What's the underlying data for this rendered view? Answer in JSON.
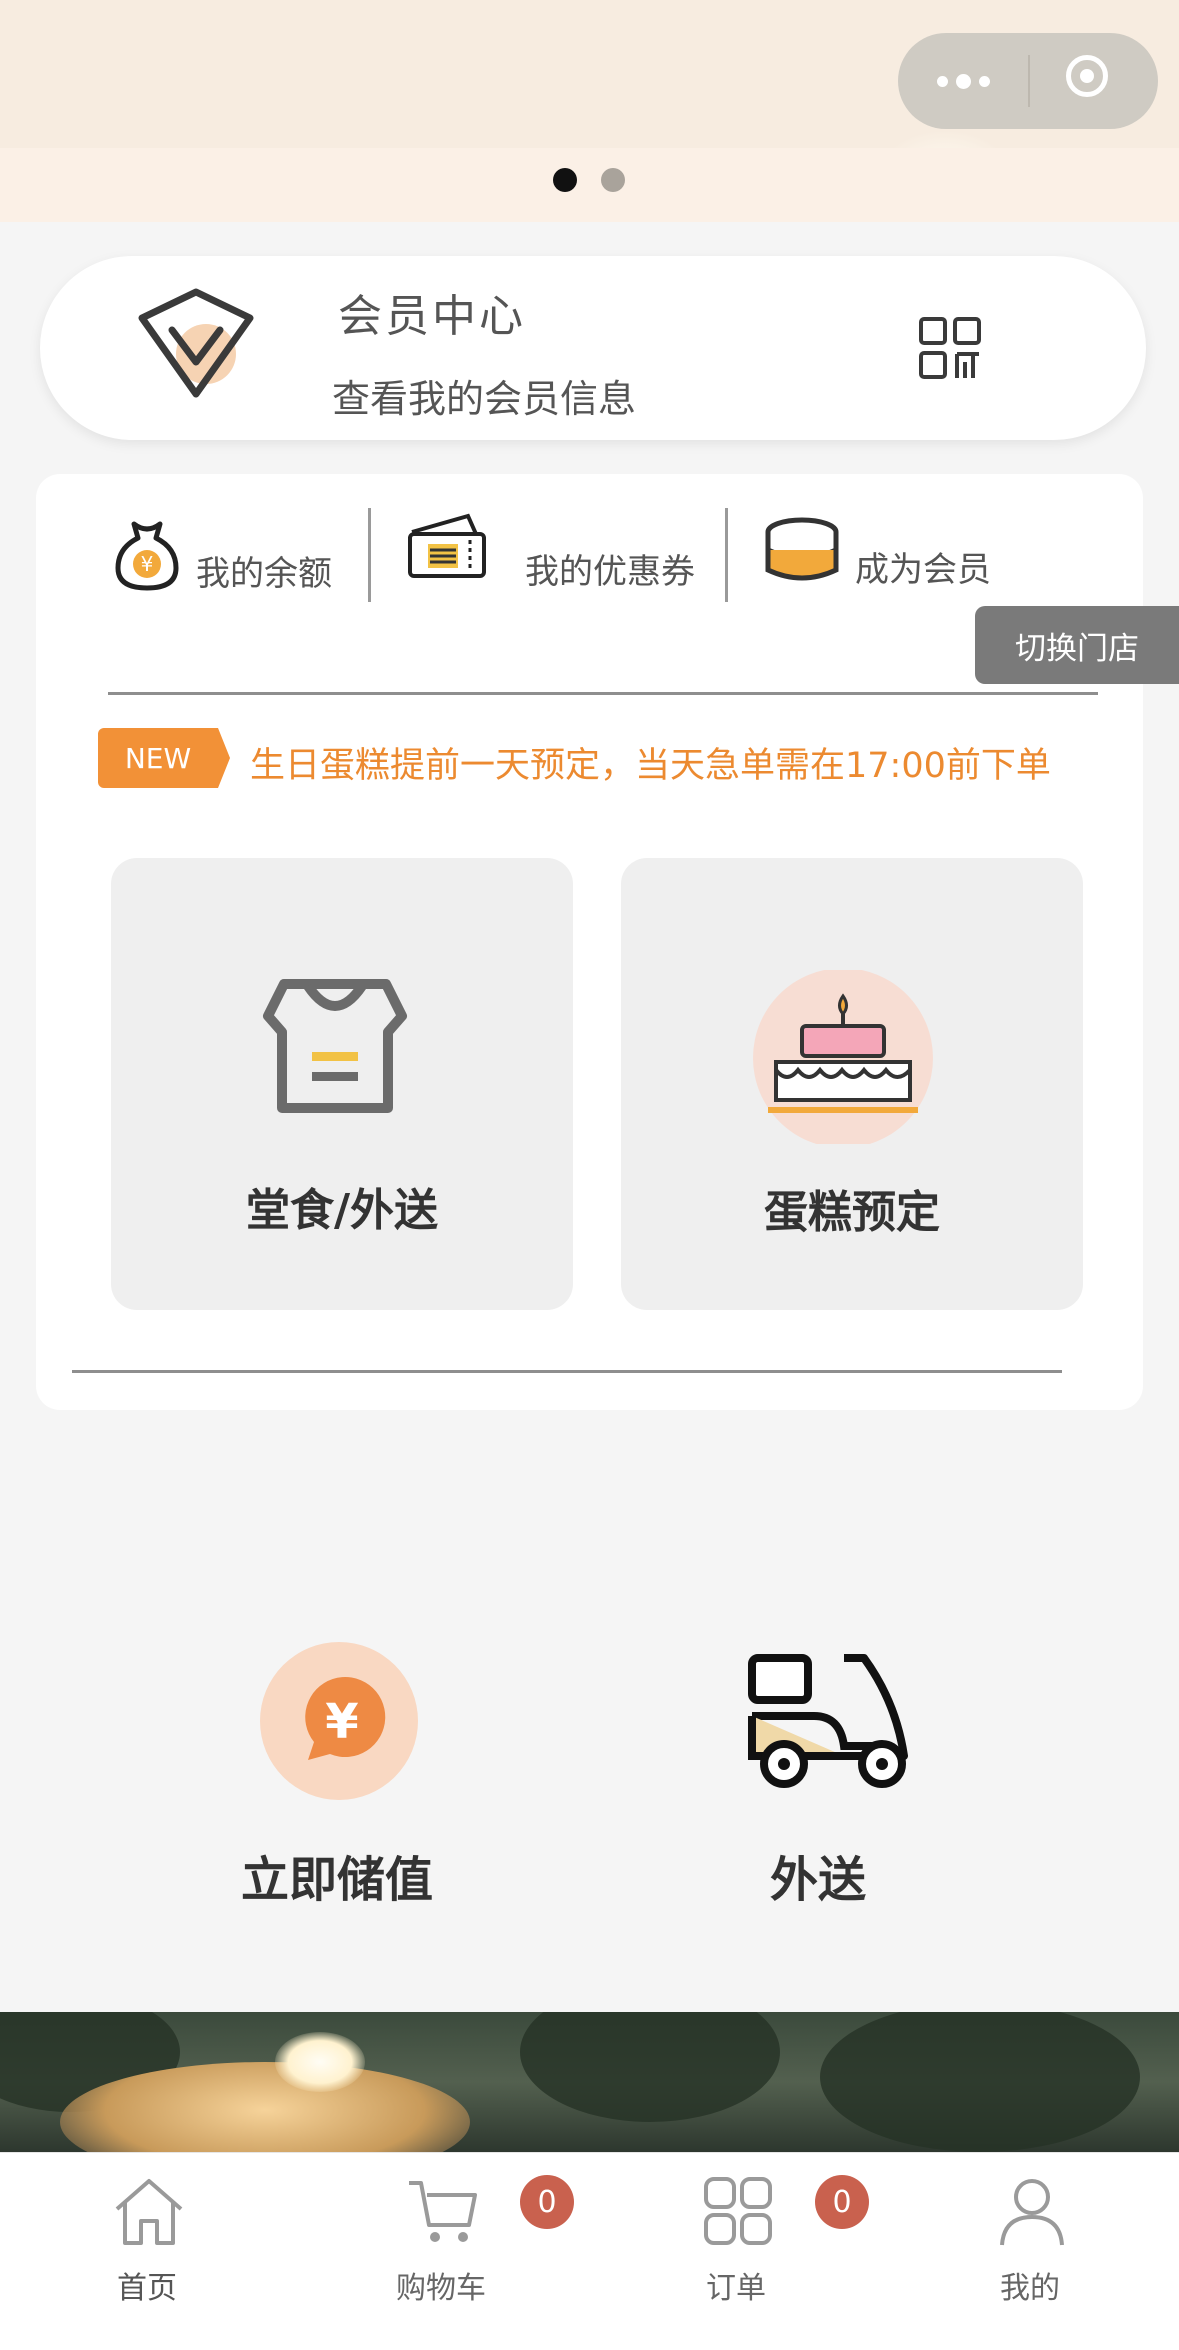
{
  "header": {
    "capsule": {
      "more_icon": "more-dots-icon",
      "close_icon": "target-circle-icon"
    },
    "banner_pages": 2,
    "banner_active_page": 1
  },
  "member": {
    "title": "会员中心",
    "subtitle": "查看我的会员信息",
    "badge_icon": "vip-diamond-icon",
    "qr_icon": "qr-code-icon"
  },
  "stats": [
    {
      "label": "我的余额",
      "icon": "money-bag-icon"
    },
    {
      "label": "我的优惠券",
      "icon": "coupon-icon"
    },
    {
      "label": "成为会员",
      "icon": "coin-stack-icon"
    }
  ],
  "switch_store": "切换门店",
  "notice": {
    "badge": "NEW",
    "text": "生日蛋糕提前一天预定，当天急单需在17:00前下单"
  },
  "tiles": [
    {
      "label": "堂食/外送",
      "icon": "shop-icon"
    },
    {
      "label": "蛋糕预定",
      "icon": "cake-icon"
    }
  ],
  "actions": [
    {
      "label": "立即储值",
      "icon": "yen-recharge-icon"
    },
    {
      "label": "外送",
      "icon": "scooter-icon"
    }
  ],
  "tabbar": [
    {
      "label": "首页",
      "icon": "home-icon"
    },
    {
      "label": "购物车",
      "icon": "cart-icon",
      "count": "0"
    },
    {
      "label": "订单",
      "icon": "grid-icon",
      "count": "0"
    },
    {
      "label": "我的",
      "icon": "user-icon"
    }
  ],
  "colors": {
    "accent": "#f29137",
    "badge": "#c9614e",
    "background": "#f5f5f5"
  }
}
